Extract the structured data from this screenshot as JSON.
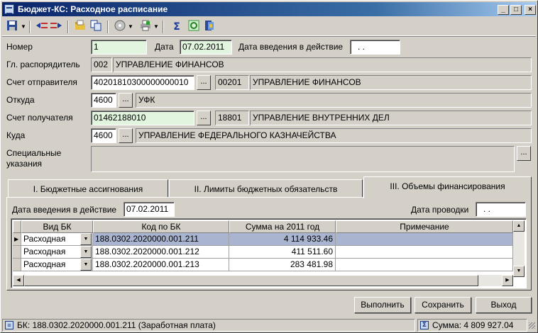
{
  "window": {
    "title": "Бюджет-КС: Расходное расписание",
    "minimize_glyph": "_",
    "maximize_glyph": "□",
    "close_glyph": "×"
  },
  "toolbar": {
    "icons": [
      "save-icon",
      "indent-in-icon",
      "indent-out-icon",
      "open-folder-icon",
      "copy-icon",
      "disc-icon",
      "print-icon",
      "sum-icon",
      "refresh-icon",
      "export-icon"
    ]
  },
  "form": {
    "number_label": "Номер",
    "number_value": "1",
    "date_label": "Дата",
    "date_value": "07.02.2011",
    "effective_date_label": "Дата введения в действие",
    "effective_date_value": ". .",
    "chief_manager_label": "Гл. распорядитель",
    "chief_manager_code": "002",
    "chief_manager_name": "УПРАВЛЕНИЕ ФИНАНСОВ",
    "sender_account_label": "Счет отправителя",
    "sender_account_value": "40201810300000000010",
    "sender_code": "00201",
    "sender_name": "УПРАВЛЕНИЕ ФИНАНСОВ",
    "from_label": "Откуда",
    "from_code": "4600",
    "from_name": "УФК",
    "recipient_account_label": "Счет получателя",
    "recipient_account_value": "01462188010",
    "recipient_code": "18801",
    "recipient_name": "УПРАВЛЕНИЕ ВНУТРЕННИХ ДЕЛ",
    "to_label": "Куда",
    "to_code": "4600",
    "to_name": "УПРАВЛЕНИЕ ФЕДЕРАЛЬНОГО КАЗНАЧЕЙСТВА",
    "special_label_1": "Специальные",
    "special_label_2": "указания",
    "special_value": "",
    "ellipsis": "..."
  },
  "tabs": [
    {
      "label": "I. Бюджетные ассигнования",
      "active": false
    },
    {
      "label": "II. Лимиты бюджетных обязательств",
      "active": false
    },
    {
      "label": "III. Объемы финансирования",
      "active": true
    }
  ],
  "panel": {
    "effective_date_label": "Дата введения в действие",
    "effective_date_value": "07.02.2011",
    "posting_date_label": "Дата проводки",
    "posting_date_value": ". ."
  },
  "grid": {
    "columns": [
      "Вид БК",
      "Код по БК",
      "Сумма на 2011 год",
      "Примечание"
    ],
    "rows": [
      {
        "type": "Расходная",
        "code": "188.0302.2020000.001.211",
        "amount": "4 114 933.46",
        "note": "",
        "selected": true
      },
      {
        "type": "Расходная",
        "code": "188.0302.2020000.001.212",
        "amount": "411 511.60",
        "note": "",
        "selected": false
      },
      {
        "type": "Расходная",
        "code": "188.0302.2020000.001.213",
        "amount": "283 481.98",
        "note": "",
        "selected": false
      }
    ]
  },
  "buttons": {
    "execute": "Выполнить",
    "save": "Сохранить",
    "exit": "Выход"
  },
  "status": {
    "bk_text": "БК: 188.0302.2020000.001.211 (Заработная плата)",
    "sum_text": "Сумма: 4 809 927.04"
  }
}
